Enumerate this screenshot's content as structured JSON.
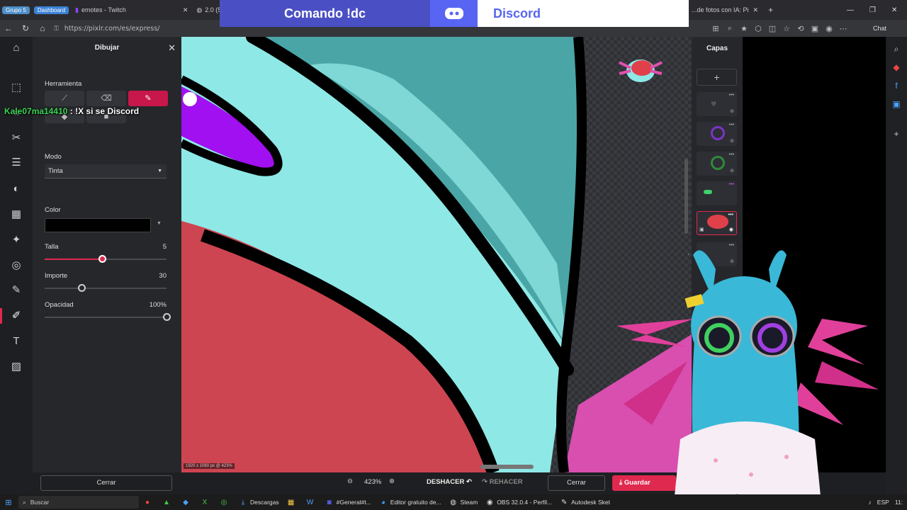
{
  "browser": {
    "group_label": "Grupo 5",
    "dashboard_label": "Dashboard",
    "tabs": [
      {
        "label": "emotes - Twitch"
      },
      {
        "label": "2.0 (5"
      },
      {
        "label": "...de fotos con IA: Pi"
      }
    ],
    "url": "https://pixlr.com/es/express/",
    "chat_button": "Chat"
  },
  "banner": {
    "command": "Comando !dc",
    "discord": "Discord"
  },
  "chat_overlay": {
    "user": "ale07ma14410",
    "message": " : !X si se Discord"
  },
  "panel": {
    "title": "Dibujar",
    "tool_label": "Herramienta",
    "mode_label": "Modo",
    "mode_value": "Tinta",
    "color_label": "Color",
    "color_value": "#000000",
    "size_label": "Talla",
    "size_value": "5",
    "size_fraction": 0.47,
    "amount_label": "Importe",
    "amount_value": "30",
    "amount_fraction": 0.3,
    "opacity_label": "Opacidad",
    "opacity_value": "100%",
    "opacity_fraction": 1.0,
    "close_label": "Cerrar"
  },
  "canvas": {
    "info": "1920 x 1080 px @ 423%"
  },
  "layers": {
    "title": "Capas",
    "add": "+"
  },
  "bottom": {
    "zoom": "423%",
    "undo": "DESHACER",
    "redo": "REHACER",
    "close": "Cerrar",
    "save": "Guardar"
  },
  "taskbar": {
    "search": "Buscar",
    "apps": [
      {
        "label": "Descargas"
      },
      {
        "label": "#General#t..."
      },
      {
        "label": "Editor gratuito de..."
      },
      {
        "label": "Steam"
      },
      {
        "label": "OBS 32.0.4 - Perfil..."
      },
      {
        "label": "Autodesk Sket"
      }
    ],
    "lang": "ESP",
    "time": "11:"
  },
  "colors": {
    "accent": "#e0294f",
    "discord": "#5865f2",
    "canvas_cyan": "#8ee8e6",
    "canvas_teal": "#4aa6a6",
    "canvas_red": "#cc4550",
    "canvas_purple": "#a010f0",
    "canvas_pink": "#d84fb0"
  }
}
